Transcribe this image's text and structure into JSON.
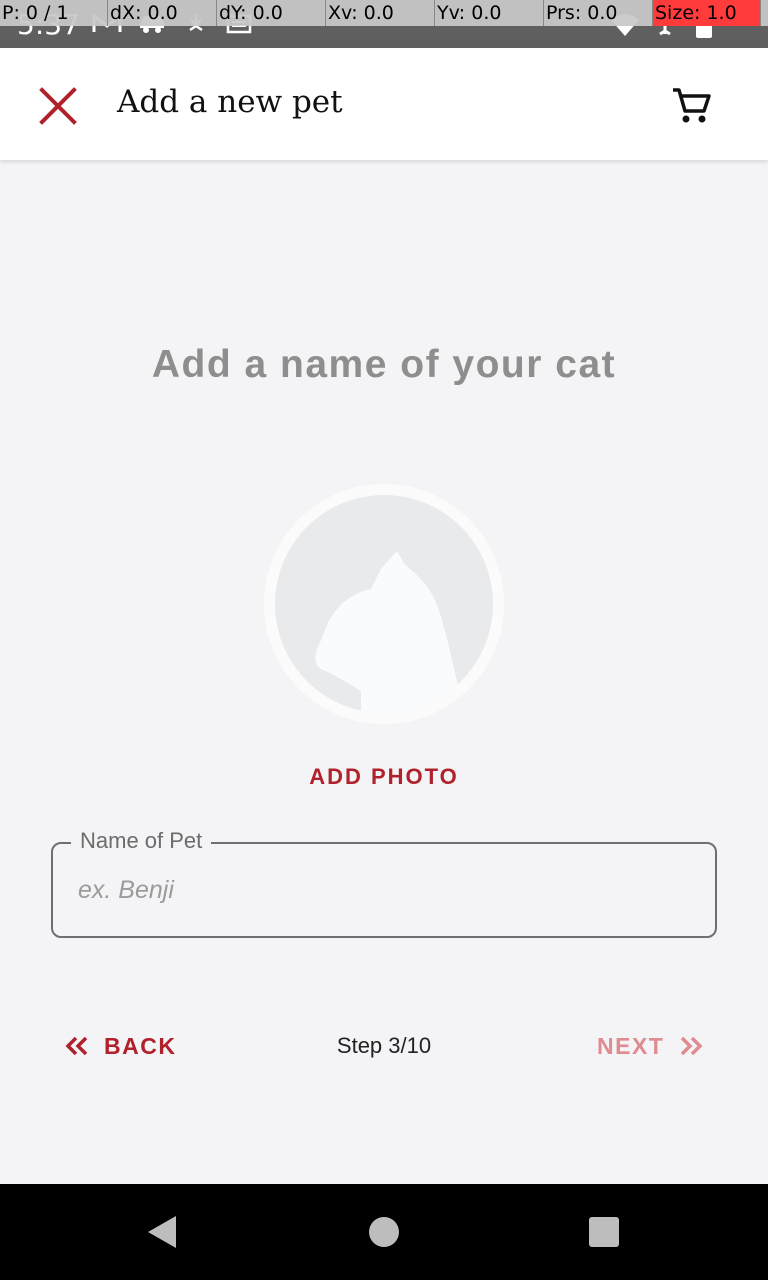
{
  "status_bar": {
    "time": "5:37",
    "icons": [
      "gmail-icon",
      "car-icon",
      "download-icon",
      "news-icon",
      "wifi-icon",
      "airplane-icon",
      "battery-icon"
    ]
  },
  "debug_overlay": {
    "pointer": "P: 0 / 1",
    "dx": "dX: 0.0",
    "dy": "dY: 0.0",
    "xv": "Xv: 0.0",
    "yv": "Yv: 0.0",
    "prs": "Prs: 0.0",
    "size": "Size: 1.0"
  },
  "app_bar": {
    "title": "Add a new pet",
    "close_icon": "close-icon",
    "cart_icon": "cart-icon"
  },
  "main": {
    "heading": "Add a name of your cat",
    "photo": {
      "placeholder_icon": "cat-silhouette-icon"
    },
    "add_photo_label": "ADD PHOTO",
    "name_field": {
      "label": "Name of Pet",
      "placeholder": "ex. Benji",
      "value": ""
    }
  },
  "footer": {
    "back_label": "BACK",
    "step_text": "Step 3/10",
    "next_label": "NEXT"
  },
  "colors": {
    "accent": "#b0212b",
    "accent_disabled": "#e08a91",
    "background": "#f4f4f6",
    "heading": "#8e8e8e"
  }
}
